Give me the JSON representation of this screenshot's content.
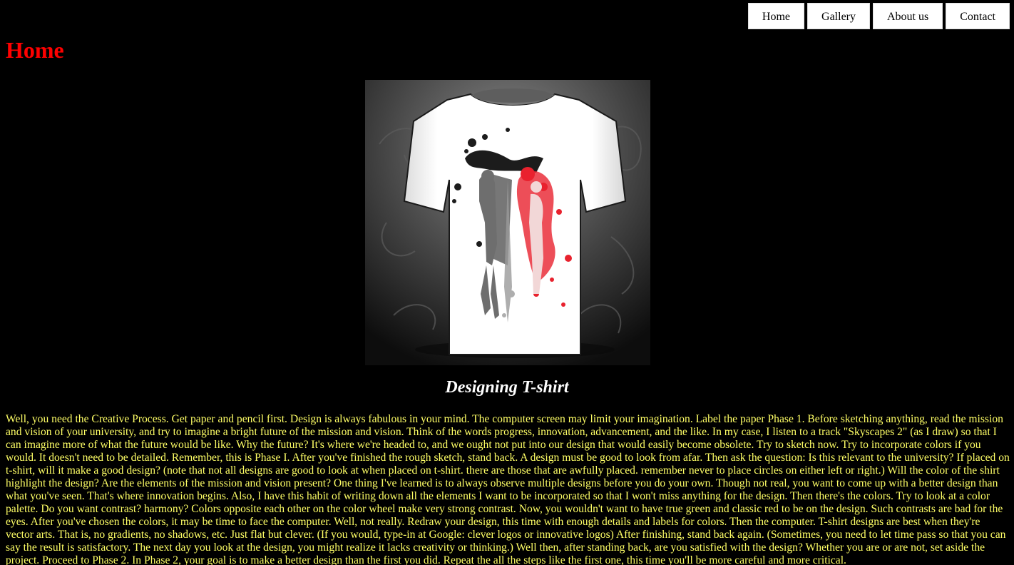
{
  "nav": {
    "items": [
      {
        "label": "Home"
      },
      {
        "label": "Gallery"
      },
      {
        "label": "About us"
      },
      {
        "label": "Contact"
      }
    ]
  },
  "page": {
    "title": "Home"
  },
  "hero": {
    "caption": "Designing T-shirt"
  },
  "article": {
    "text": "Well, you need the Creative Process. Get paper and pencil first. Design is always fabulous in your mind. The computer screen may limit your imagination. Label the paper Phase 1. Before sketching anything, read the mission and vision of your university, and try to imagine a bright future of the mission and vision. Think of the words progress, innovation, advancement, and the like. In my case, I listen to a track \"Skyscapes 2\" (as I draw) so that I can imagine more of what the future would be like. Why the future? It's where we're headed to, and we ought not put into our design that would easily become obsolete. Try to sketch now. Try to incorporate colors if you would. It doesn't need to be detailed. Remember, this is Phase I. After you've finished the rough sketch, stand back. A design must be good to look from afar. Then ask the question: Is this relevant to the university? If placed on t-shirt, will it make a good design? (note that not all designs are good to look at when placed on t-shirt. there are those that are awfully placed. remember never to place circles on either left or right.) Will the color of the shirt highlight the design? Are the elements of the mission and vision present? One thing I've learned is to always observe multiple designs before you do your own. Though not real, you want to come up with a better design than what you've seen. That's where innovation begins. Also, I have this habit of writing down all the elements I want to be incorporated so that I won't miss anything for the design. Then there's the colors. Try to look at a color palette. Do you want contrast? harmony? Colors opposite each other on the color wheel make very strong contrast. Now, you wouldn't want to have true green and classic red to be on the design. Such contrasts are bad for the eyes. After you've chosen the colors, it may be time to face the computer. Well, not really. Redraw your design, this time with enough details and labels for colors. Then the computer. T-shirt designs are best when they're vector arts. That is, no gradients, no shadows, etc. Just flat but clever. (If you would, type-in at Google: clever logos or innovative logos) After finishing, stand back again. (Sometimes, you need to let time pass so that you can say the result is satisfactory. The next day you look at the design, you might realize it lacks creativity or thinking.) Well then, after standing back, are you satisfied with the design? Whether you are or are not, set aside the project. Proceed to Phase 2. In Phase 2, your goal is to make a better design than the first you did. Repeat the all the steps like the first one, this time you'll be more careful and more critical."
  },
  "colors": {
    "background": "#000000",
    "title": "#ff0000",
    "body_text": "#ffff66",
    "caption": "#ffffff",
    "accent_red": "#e8222e"
  }
}
